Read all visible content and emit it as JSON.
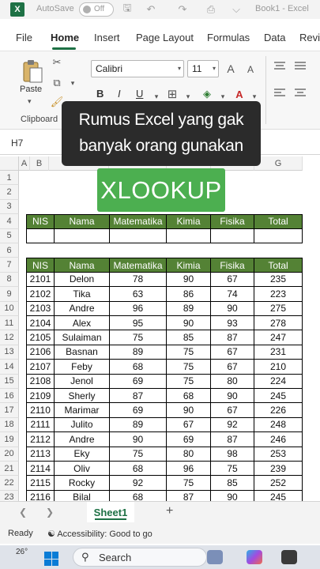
{
  "titlebar": {
    "logo": "X",
    "autosave_label": "AutoSave",
    "toggle_label": "Off",
    "book_title": "Book1 - Excel"
  },
  "tabs": [
    "File",
    "Home",
    "Insert",
    "Page Layout",
    "Formulas",
    "Data",
    "Revi"
  ],
  "ribbon": {
    "paste_label": "Paste",
    "clipboard_label": "Clipboard",
    "font_name": "Calibri",
    "font_size": "11",
    "bold": "B",
    "italic": "I",
    "underline": "U",
    "grow_font": "A",
    "shrink_font": "A"
  },
  "name_box": "H7",
  "columns": [
    "A",
    "B",
    "C",
    "D",
    "E",
    "F",
    "G"
  ],
  "rows": [
    "1",
    "2",
    "3",
    "4",
    "5",
    "6",
    "7",
    "8",
    "9",
    "10",
    "11",
    "12",
    "13",
    "14",
    "15",
    "16",
    "17",
    "18",
    "19",
    "20",
    "21",
    "22",
    "23"
  ],
  "lookup_table": {
    "headers": [
      "NIS",
      "Nama",
      "Matematika",
      "Kimia",
      "Fisika",
      "Total"
    ]
  },
  "data_table": {
    "headers": [
      "NIS",
      "Nama",
      "Matematika",
      "Kimia",
      "Fisika",
      "Total"
    ],
    "rows": [
      [
        "2101",
        "Delon",
        "78",
        "90",
        "67",
        "235"
      ],
      [
        "2102",
        "Tika",
        "63",
        "86",
        "74",
        "223"
      ],
      [
        "2103",
        "Andre",
        "96",
        "89",
        "90",
        "275"
      ],
      [
        "2104",
        "Alex",
        "95",
        "90",
        "93",
        "278"
      ],
      [
        "2105",
        "Sulaiman",
        "75",
        "85",
        "87",
        "247"
      ],
      [
        "2106",
        "Basnan",
        "89",
        "75",
        "67",
        "231"
      ],
      [
        "2107",
        "Feby",
        "68",
        "75",
        "67",
        "210"
      ],
      [
        "2108",
        "Jenol",
        "69",
        "75",
        "80",
        "224"
      ],
      [
        "2109",
        "Sherly",
        "87",
        "68",
        "90",
        "245"
      ],
      [
        "2110",
        "Marimar",
        "69",
        "90",
        "67",
        "226"
      ],
      [
        "2111",
        "Julito",
        "89",
        "67",
        "92",
        "248"
      ],
      [
        "2112",
        "Andre",
        "90",
        "69",
        "87",
        "246"
      ],
      [
        "2113",
        "Eky",
        "75",
        "80",
        "98",
        "253"
      ],
      [
        "2114",
        "Oliv",
        "68",
        "96",
        "75",
        "239"
      ],
      [
        "2115",
        "Rocky",
        "92",
        "75",
        "85",
        "252"
      ],
      [
        "2116",
        "Bilal",
        "68",
        "87",
        "90",
        "245"
      ]
    ]
  },
  "overlay": {
    "caption_line1": "Rumus Excel yang gak",
    "caption_line2": "banyak orang gunakan",
    "badge": "XLOOKUP"
  },
  "sheets": {
    "active": "Sheet1",
    "add": "+"
  },
  "status": {
    "ready": "Ready",
    "accessibility": "Accessibility: Good to go"
  },
  "taskbar": {
    "temperature": "26°",
    "search_label": "Search"
  },
  "colors": {
    "header_green": "#548235",
    "badge_green": "#4caf50",
    "excel_green": "#1e7145"
  }
}
